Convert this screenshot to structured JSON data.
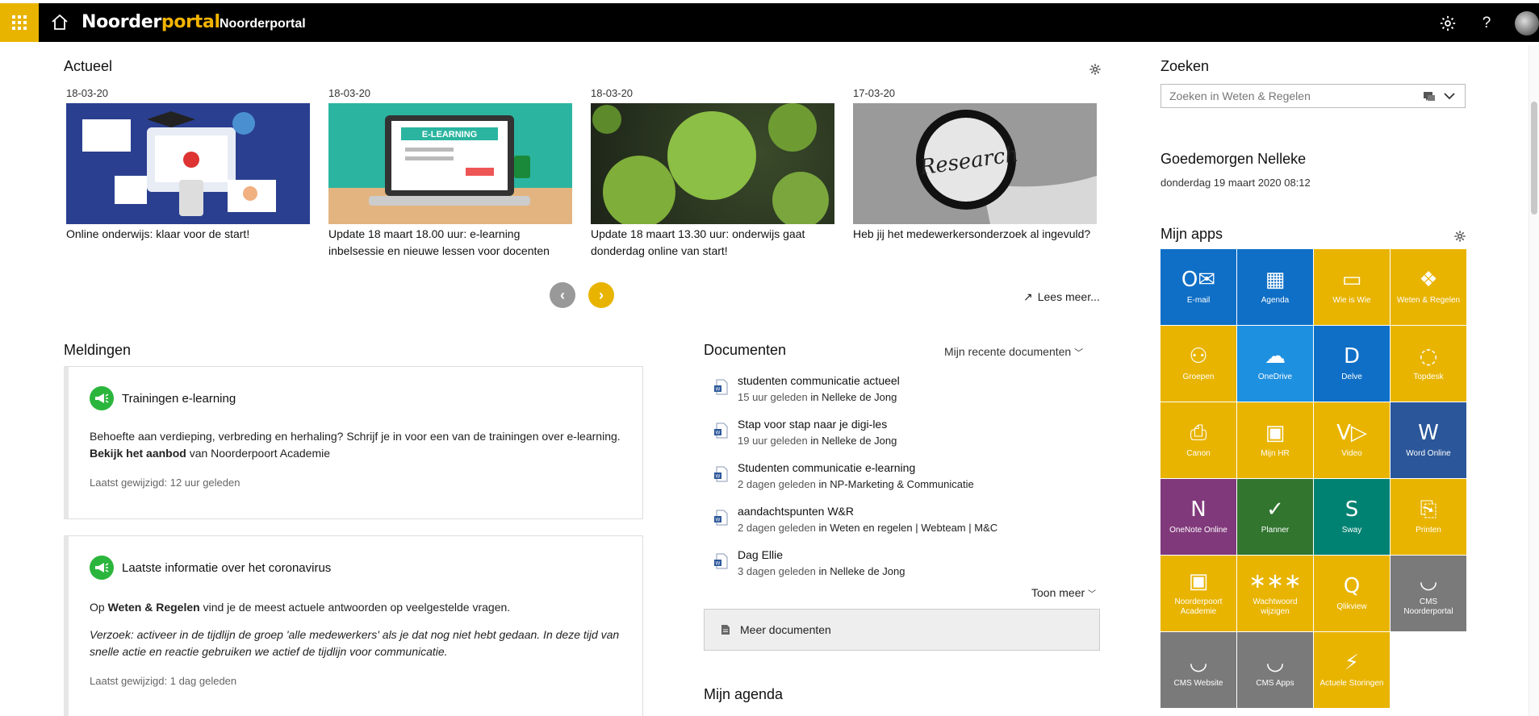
{
  "topbar": {
    "logo_left": "Noorder",
    "logo_right": "portal",
    "site_title": "Noorderportal",
    "help_label": "?"
  },
  "actueel": {
    "title": "Actueel",
    "items": [
      {
        "date": "18-03-20",
        "caption": "Online onderwijs: klaar voor de start!"
      },
      {
        "date": "18-03-20",
        "caption": "Update 18 maart 18.00 uur: e-learning inbelsessie en nieuwe lessen voor docenten",
        "img_text": "E-LEARNING"
      },
      {
        "date": "18-03-20",
        "caption": "Update 18 maart 13.30 uur: onderwijs gaat donderdag online van start!"
      },
      {
        "date": "17-03-20",
        "caption": "Heb jij het medewerkersonderzoek al ingevuld?",
        "img_text": "Research"
      }
    ],
    "prev_label": "‹",
    "next_label": "›",
    "read_more": "Lees meer..."
  },
  "meldingen": {
    "title": "Meldingen",
    "cards": [
      {
        "title": "Trainingen e-learning",
        "body": "Behoefte aan verdieping, verbreding en herhaling? Schrijf je in voor een van de trainingen over e-learning.",
        "link": "Bekijk het aanbod",
        "link_suffix": " van Noorderpoort Academie",
        "meta": "Laatst gewijzigd: 12 uur geleden"
      },
      {
        "title": "Laatste informatie over het coronavirus",
        "body_prefix": "Op ",
        "link": "Weten & Regelen",
        "body_suffix": " vind je de meest actuele antwoorden op veelgestelde vragen.",
        "note": "Verzoek: activeer in de tijdlijn de groep 'alle medewerkers' als je dat nog niet hebt gedaan. In deze tijd van snelle actie en reactie gebruiken we actief de tijdlijn voor communicatie.",
        "meta": "Laatst gewijzigd: 1 dag geleden"
      }
    ]
  },
  "documenten": {
    "title": "Documenten",
    "filter": "Mijn recente documenten",
    "items": [
      {
        "name": "studenten communicatie actueel",
        "time": "15 uur geleden",
        "in": "in",
        "location": "Nelleke de Jong"
      },
      {
        "name": "Stap voor stap naar je digi-les",
        "time": "19 uur geleden",
        "in": "in",
        "location": "Nelleke de Jong"
      },
      {
        "name": "Studenten communicatie e-learning",
        "time": "2 dagen geleden",
        "in": "in",
        "location": "NP-Marketing & Communicatie"
      },
      {
        "name": "aandachtspunten W&R",
        "time": "2 dagen geleden",
        "in": "in",
        "location": "Weten en regelen | Webteam | M&C"
      },
      {
        "name": "Dag Ellie",
        "time": "3 dagen geleden",
        "in": "in",
        "location": "Nelleke de Jong"
      }
    ],
    "show_more": "Toon meer",
    "more_docs": "Meer documenten"
  },
  "agenda": {
    "title": "Mijn agenda"
  },
  "zoeken": {
    "title": "Zoeken",
    "placeholder": "Zoeken in Weten & Regelen"
  },
  "greeting": {
    "text": "Goedemorgen Nelleke",
    "date": "donderdag 19 maart 2020 08:12"
  },
  "apps": {
    "title": "Mijn apps",
    "tiles": [
      {
        "label": "E-mail",
        "color": "#0f6fc6",
        "icon": "O✉"
      },
      {
        "label": "Agenda",
        "color": "#0f6fc6",
        "icon": "▦"
      },
      {
        "label": "Wie is Wie",
        "color": "#e8b400",
        "icon": "▭"
      },
      {
        "label": "Weten & Regelen",
        "color": "#e8b400",
        "icon": "❖"
      },
      {
        "label": "Groepen",
        "color": "#e8b400",
        "icon": "⚇"
      },
      {
        "label": "OneDrive",
        "color": "#1e90e0",
        "icon": "☁"
      },
      {
        "label": "Delve",
        "color": "#0f6fc6",
        "icon": "D"
      },
      {
        "label": "Topdesk",
        "color": "#e8b400",
        "icon": "◌"
      },
      {
        "label": "Canon",
        "color": "#e8b400",
        "icon": "⎙"
      },
      {
        "label": "Mijn HR",
        "color": "#e8b400",
        "icon": "▣"
      },
      {
        "label": "Video",
        "color": "#e8b400",
        "icon": "V▷"
      },
      {
        "label": "Word Online",
        "color": "#2b579a",
        "icon": "W"
      },
      {
        "label": "OneNote Online",
        "color": "#80397b",
        "icon": "N"
      },
      {
        "label": "Planner",
        "color": "#31752f",
        "icon": "✓"
      },
      {
        "label": "Sway",
        "color": "#008272",
        "icon": "S"
      },
      {
        "label": "Printen",
        "color": "#e8b400",
        "icon": "⎘"
      },
      {
        "label": "Noorderpoort Academie",
        "color": "#e8b400",
        "icon": "▣"
      },
      {
        "label": "Wachtwoord wijzigen",
        "color": "#e8b400",
        "icon": "∗∗∗"
      },
      {
        "label": "Qlikview",
        "color": "#e8b400",
        "icon": "Q"
      },
      {
        "label": "CMS Noorderportal",
        "color": "#7a7a7a",
        "icon": "◡"
      },
      {
        "label": "CMS Website",
        "color": "#7a7a7a",
        "icon": "◡"
      },
      {
        "label": "CMS Apps",
        "color": "#7a7a7a",
        "icon": "◡"
      },
      {
        "label": "Actuele Storingen",
        "color": "#e8b400",
        "icon": "⚡"
      }
    ]
  }
}
